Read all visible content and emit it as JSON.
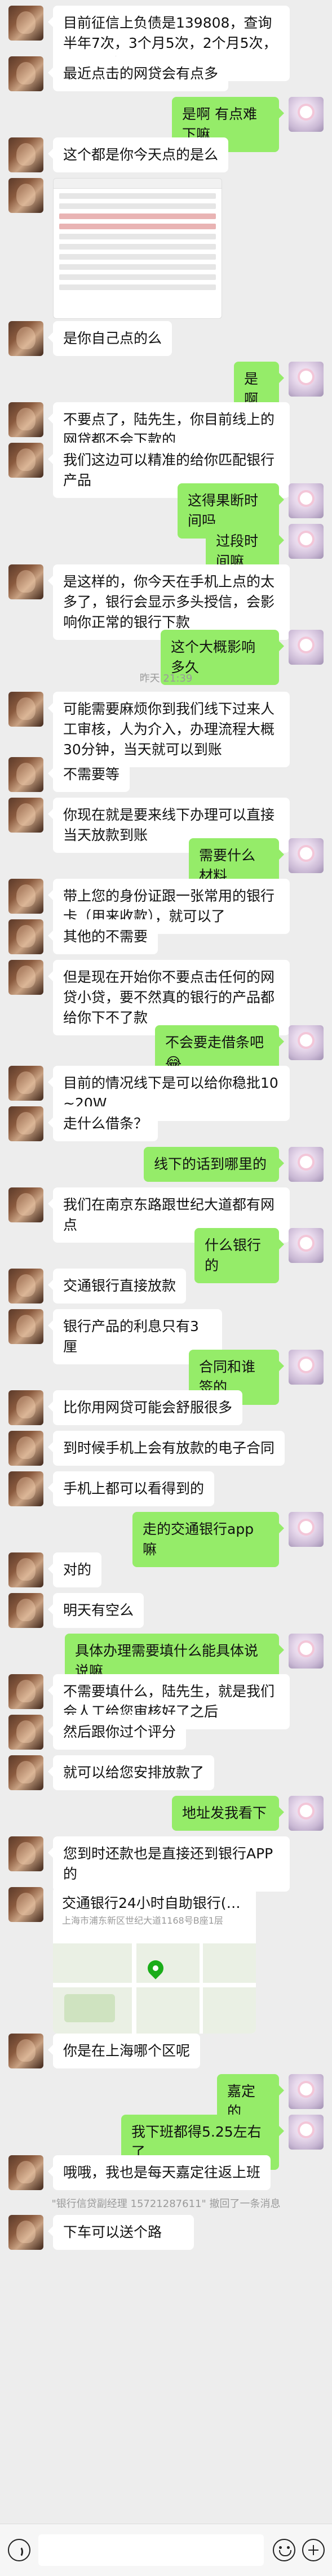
{
  "messages": [
    {
      "side": "left",
      "type": "text",
      "text": "目前征信上负债是139808，查询半年7次，3个月5次，2个月5次，1个月5次"
    },
    {
      "side": "left",
      "type": "text",
      "text": "最近点击的网贷会有点多"
    },
    {
      "side": "right",
      "type": "text",
      "text": "是啊 有点难下嘛"
    },
    {
      "side": "left",
      "type": "text",
      "text": "这个都是你今天点的是么"
    },
    {
      "side": "left",
      "type": "image",
      "text": "征信查询记录截图"
    },
    {
      "side": "left",
      "type": "text",
      "text": "是你自己点的么"
    },
    {
      "side": "right",
      "type": "text",
      "text": "是啊"
    },
    {
      "side": "left",
      "type": "text",
      "text": "不要点了，陆先生，你目前线上的网贷都不会下款的"
    },
    {
      "side": "left",
      "type": "text",
      "text": "我们这边可以精准的给你匹配银行产品"
    },
    {
      "side": "right",
      "type": "text",
      "text": "这得果断时间吗"
    },
    {
      "side": "right",
      "type": "text",
      "text": "过段时间嘛"
    },
    {
      "side": "left",
      "type": "text",
      "text": "是这样的，你今天在手机上点的太多了，银行会显示多头授信，会影响你正常的银行下款"
    },
    {
      "side": "right",
      "type": "text",
      "text": "这个大概影响多久"
    },
    {
      "side": "time",
      "type": "time",
      "text": "昨天 21:39"
    },
    {
      "side": "left",
      "type": "text",
      "text": "可能需要麻烦你到我们线下过来人工审核，人为介入，办理流程大概30分钟，当天就可以到账"
    },
    {
      "side": "left",
      "type": "text",
      "text": "不需要等"
    },
    {
      "side": "left",
      "type": "text",
      "text": "你现在就是要来线下办理可以直接当天放款到账"
    },
    {
      "side": "right",
      "type": "text",
      "text": "需要什么材料"
    },
    {
      "side": "left",
      "type": "text",
      "text": "带上您的身份证跟一张常用的银行卡（用来收款），就可以了"
    },
    {
      "side": "left",
      "type": "text",
      "text": "其他的不需要"
    },
    {
      "side": "left",
      "type": "text",
      "text": "但是现在开始你不要点击任何的网贷小贷，要不然真的银行的产品都给你下不了款"
    },
    {
      "side": "right",
      "type": "text",
      "text": "不会要走借条吧😂"
    },
    {
      "side": "left",
      "type": "text",
      "text": "目前的情况线下是可以给你稳批10~20W"
    },
    {
      "side": "left",
      "type": "text",
      "text": "走什么借条？"
    },
    {
      "side": "right",
      "type": "text",
      "text": "线下的话到哪里的"
    },
    {
      "side": "left",
      "type": "text",
      "text": "我们在南京东路跟世纪大道都有网点"
    },
    {
      "side": "right",
      "type": "text",
      "text": "什么银行的"
    },
    {
      "side": "left",
      "type": "text",
      "text": "交通银行直接放款"
    },
    {
      "side": "left",
      "type": "text",
      "text": "银行产品的利息只有3厘"
    },
    {
      "side": "right",
      "type": "text",
      "text": "合同和谁签的"
    },
    {
      "side": "left",
      "type": "text",
      "text": "比你用网贷可能会舒服很多"
    },
    {
      "side": "left",
      "type": "text",
      "text": "到时候手机上会有放款的电子合同"
    },
    {
      "side": "left",
      "type": "text",
      "text": "手机上都可以看得到的"
    },
    {
      "side": "right",
      "type": "text",
      "text": "走的交通银行app 嘛"
    },
    {
      "side": "left",
      "type": "text",
      "text": "对的"
    },
    {
      "side": "left",
      "type": "text",
      "text": "明天有空么"
    },
    {
      "side": "right",
      "type": "text",
      "text": "具体办理需要填什么能具体说说嘛"
    },
    {
      "side": "left",
      "type": "text",
      "text": "不需要填什么，陆先生，就是我们会人工给您审核好了之后"
    },
    {
      "side": "left",
      "type": "text",
      "text": "然后跟你过个评分"
    },
    {
      "side": "left",
      "type": "text",
      "text": "就可以给您安排放款了"
    },
    {
      "side": "right",
      "type": "text",
      "text": "地址发我看下"
    },
    {
      "side": "left",
      "type": "text",
      "text": "您到时还款也是直接还到银行APP的"
    },
    {
      "side": "left",
      "type": "location",
      "text": "交通银行24小时自助银行(上...",
      "sub": "上海市浦东新区世纪大道1168号B座1层"
    },
    {
      "side": "left",
      "type": "text",
      "text": "你是在上海哪个区呢"
    },
    {
      "side": "right",
      "type": "text",
      "text": "嘉定的"
    },
    {
      "side": "right",
      "type": "text",
      "text": "我下班都得5.25左右了"
    },
    {
      "side": "left",
      "type": "text",
      "text": "哦哦，我也是每天嘉定往返上班"
    },
    {
      "side": "system",
      "type": "system",
      "text": "\"银行信贷副经理 15721287611\" 撤回了一条消息"
    },
    {
      "side": "left",
      "type": "text",
      "text": "下车可以送个路"
    }
  ],
  "input_bar": {
    "voice_icon": "voice-icon",
    "emoji_icon": "emoji-icon",
    "plus_icon": "plus-icon"
  }
}
